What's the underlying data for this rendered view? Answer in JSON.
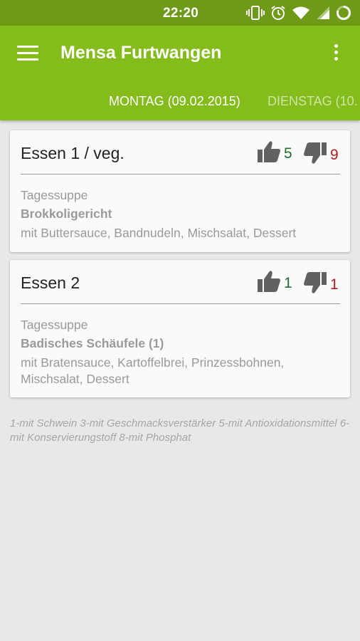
{
  "status": {
    "time": "22:20"
  },
  "app": {
    "title": "Mensa Furtwangen"
  },
  "tabs": [
    "MONTAG (09.02.2015)",
    "DIENSTAG (10."
  ],
  "meals": [
    {
      "name": "Essen 1 / veg.",
      "likes": "5",
      "dislikes": "9",
      "soup": "Tagessuppe",
      "main": "Brokkoligericht",
      "sides": "mit Buttersauce, Bandnudeln, Mischsalat, Dessert"
    },
    {
      "name": "Essen 2",
      "likes": "1",
      "dislikes": "1",
      "soup": "Tagessuppe",
      "main": "Badisches Schäufele (1)",
      "sides": "mit Bratensauce, Kartoffelbrei, Prinzessbohnen, Mischsalat, Dessert"
    }
  ],
  "footnote": "1-mit Schwein 3-mit Geschmacksverstärker 5-mit Antioxidationsmittel 6-mit Konservierungstoff 8-mit Phosphat",
  "colors": {
    "primary": "#84bc1c",
    "primary_dark": "#6f9a17",
    "like": "#1f6e2e",
    "dislike": "#b01e1e"
  },
  "icons": [
    "vibrate-icon",
    "alarm-icon",
    "wifi-icon",
    "cell-signal-icon",
    "battery-icon",
    "menu-icon",
    "overflow-icon",
    "thumbs-up-icon",
    "thumbs-down-icon"
  ]
}
